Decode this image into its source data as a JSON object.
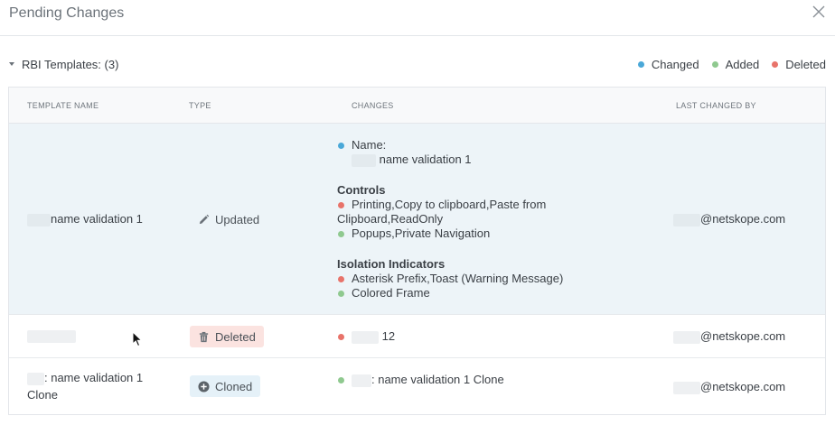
{
  "dialog": {
    "title": "Pending Changes"
  },
  "section": {
    "label": "RBI Templates: (3)"
  },
  "legend": [
    {
      "label": "Changed",
      "color": "#4aa8d8"
    },
    {
      "label": "Added",
      "color": "#8fc98f"
    },
    {
      "label": "Deleted",
      "color": "#e8736a"
    }
  ],
  "table": {
    "headers": [
      "TEMPLATE NAME",
      "TYPE",
      "CHANGES",
      "LAST CHANGED BY"
    ],
    "rows": [
      {
        "name": "name validation 1",
        "type": "Updated",
        "changes": {
          "name_label": "Name:",
          "name_value": "name validation 1",
          "controls_title": "Controls",
          "controls_deleted_1": "Printing,Copy to clipboard,Paste from",
          "controls_deleted_2": "Clipboard,ReadOnly",
          "controls_added": "Popups,Private Navigation",
          "isolation_title": "Isolation Indicators",
          "isolation_deleted": "Asterisk Prefix,Toast (Warning Message)",
          "isolation_added": "Colored Frame"
        },
        "changed_by": "@netskope.com"
      },
      {
        "name": "",
        "type": "Deleted",
        "changes": {
          "deleted": "12"
        },
        "changed_by": "@netskope.com"
      },
      {
        "name_line1": ": name validation 1",
        "name_line2": "Clone",
        "type": "Cloned",
        "changes": {
          "added": ": name validation 1 Clone"
        },
        "changed_by": "@netskope.com"
      }
    ]
  }
}
